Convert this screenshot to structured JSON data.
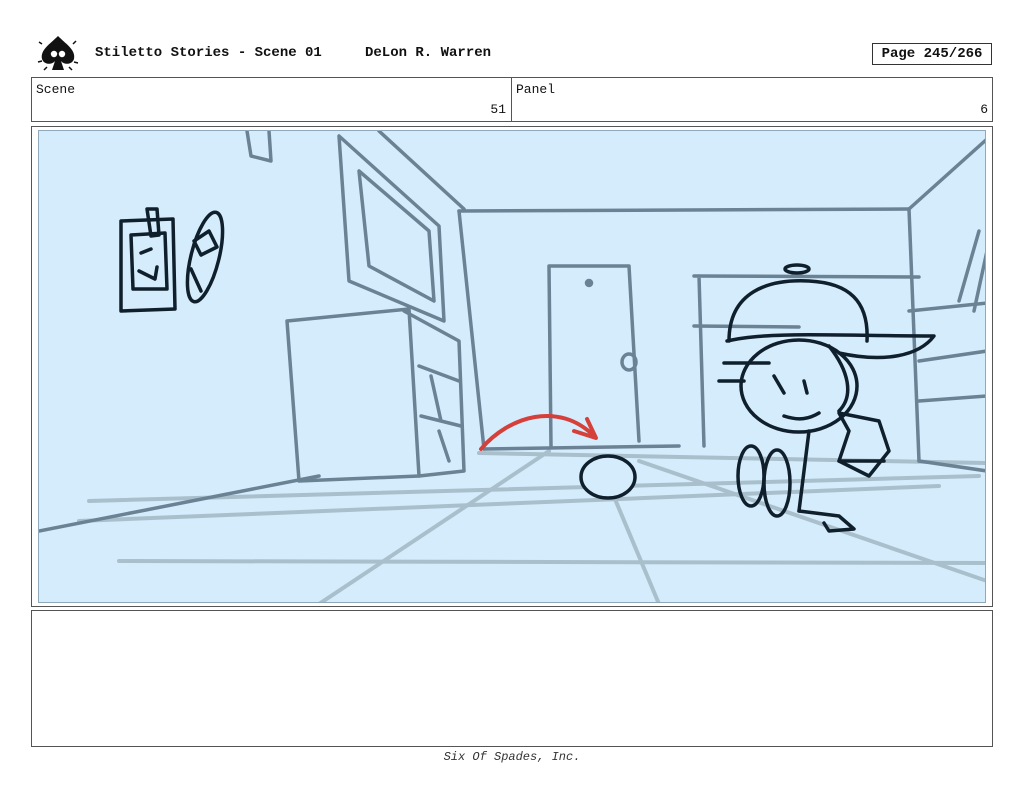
{
  "header": {
    "title": "Stiletto Stories - Scene 01",
    "author": "DeLon R. Warren",
    "page": "Page 245/266"
  },
  "info": {
    "scene_label": "Scene",
    "scene_value": "51",
    "panel_label": "Panel",
    "panel_value": "6"
  },
  "footer": {
    "company": "Six Of Spades, Inc."
  },
  "colors": {
    "panel_bg": "#d4ecfb",
    "sketch_blue": "#6a8294",
    "ink": "#0f1f2b",
    "arrow_red": "#d5403a"
  }
}
